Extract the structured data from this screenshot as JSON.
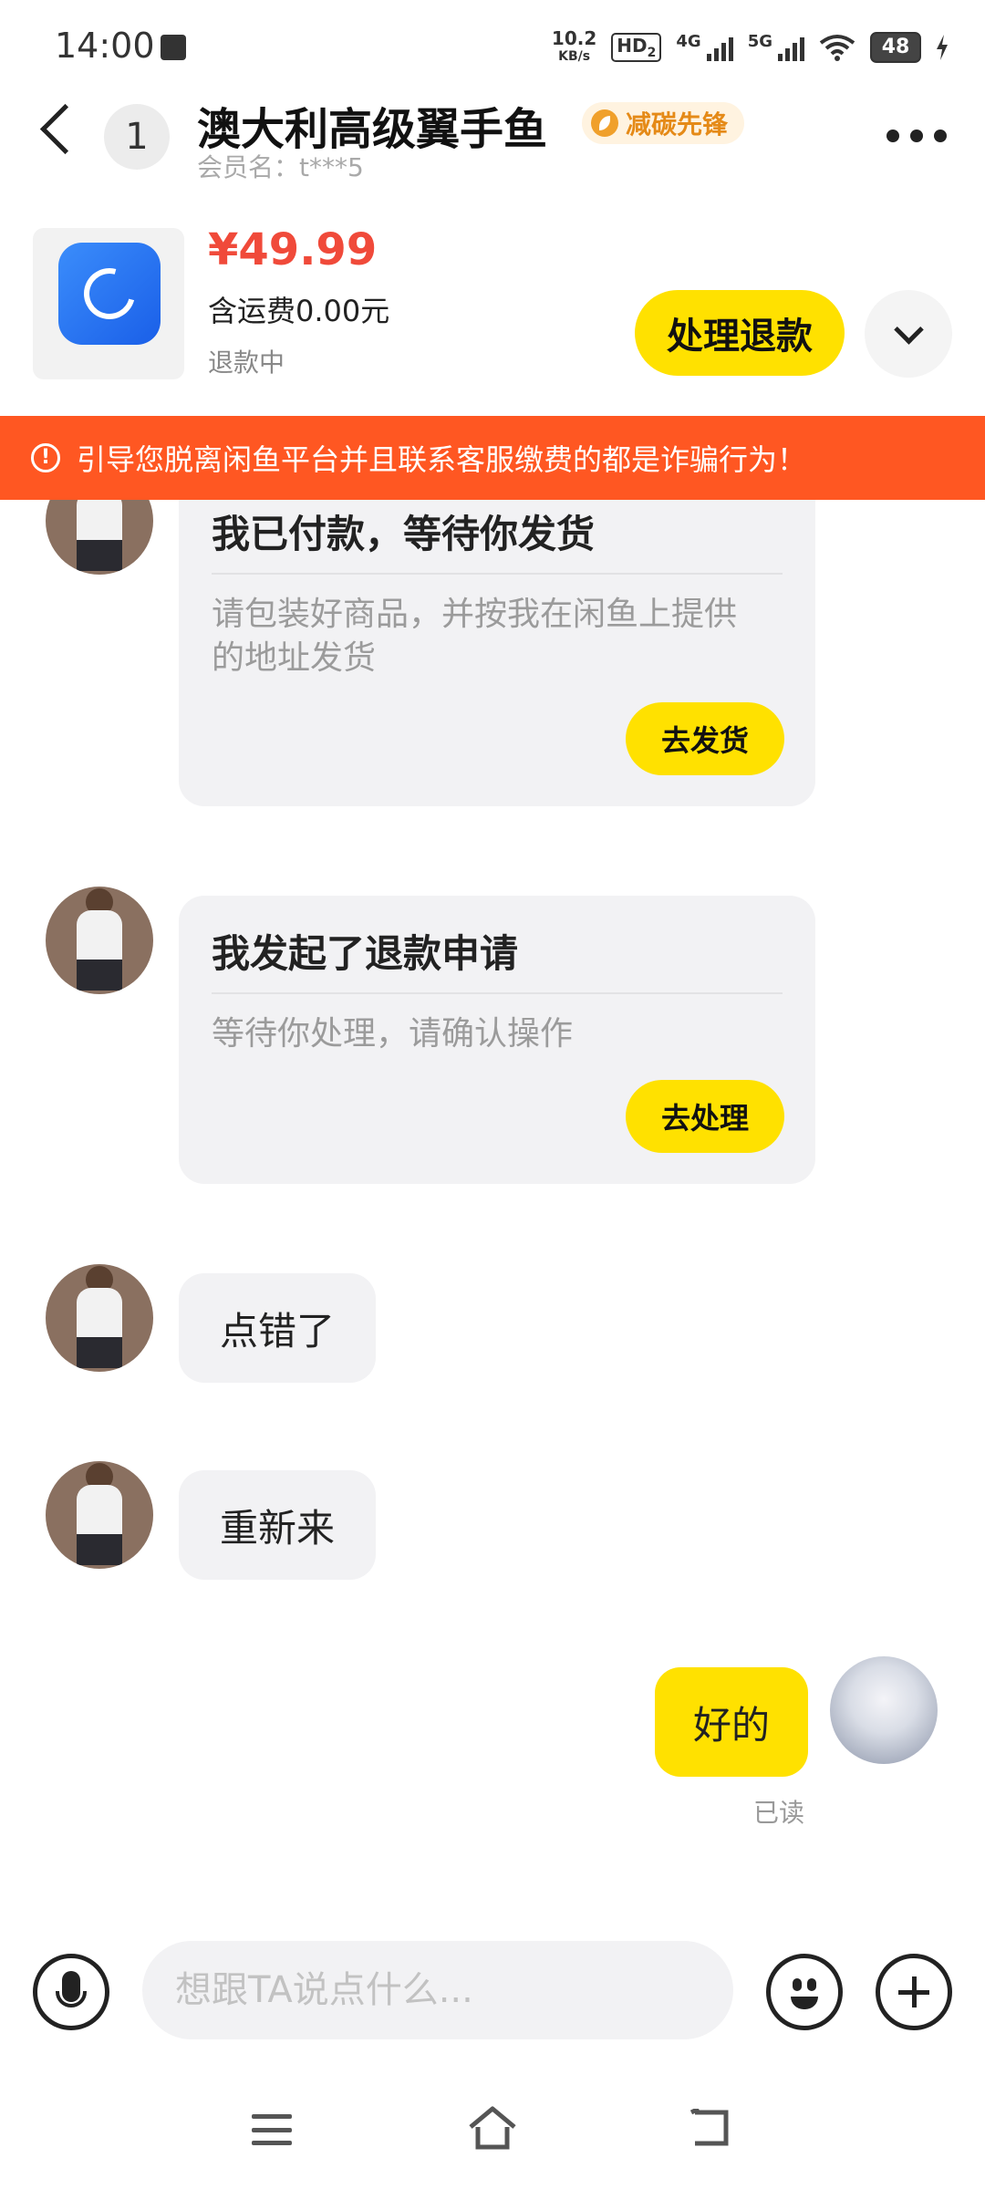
{
  "status_bar": {
    "time": "14:00",
    "net_speed_value": "10.2",
    "net_speed_unit": "KB/s",
    "hd_label": "HD",
    "hd_sub": "2",
    "sig1_label": "4G",
    "sig2_label": "5G",
    "battery": "48"
  },
  "header": {
    "unread_count": "1",
    "title": "澳大利高级翼手鱼",
    "tag": "减碳先锋",
    "member": "会员名：t***5"
  },
  "product": {
    "price": "¥49.99",
    "shipping": "含运费0.00元",
    "status": "退款中",
    "refund_button": "处理退款"
  },
  "warning": {
    "icon": "!",
    "text": "引导您脱离闲鱼平台并且联系客服缴费的都是诈骗行为！"
  },
  "messages": {
    "card1": {
      "title": "我已付款，等待你发货",
      "body": "请包装好商品，并按我在闲鱼上提供的地址发货",
      "button": "去发货"
    },
    "card2": {
      "title": "我发起了退款申请",
      "body": "等待你处理，请确认操作",
      "button": "去处理"
    },
    "msg3": "点错了",
    "msg4": "重新来",
    "my_msg": "好的",
    "read_status": "已读"
  },
  "input": {
    "placeholder": "想跟TA说点什么..."
  },
  "colors": {
    "accent_yellow": "#ffe100",
    "warning_orange": "#ff5722",
    "price_red": "#f04a3a"
  },
  "icons": [
    "back-icon",
    "more-icon",
    "chevron-down-icon",
    "warning-icon",
    "mic-icon",
    "emoji-icon",
    "plus-icon",
    "menu-icon",
    "home-icon",
    "back-nav-icon"
  ]
}
